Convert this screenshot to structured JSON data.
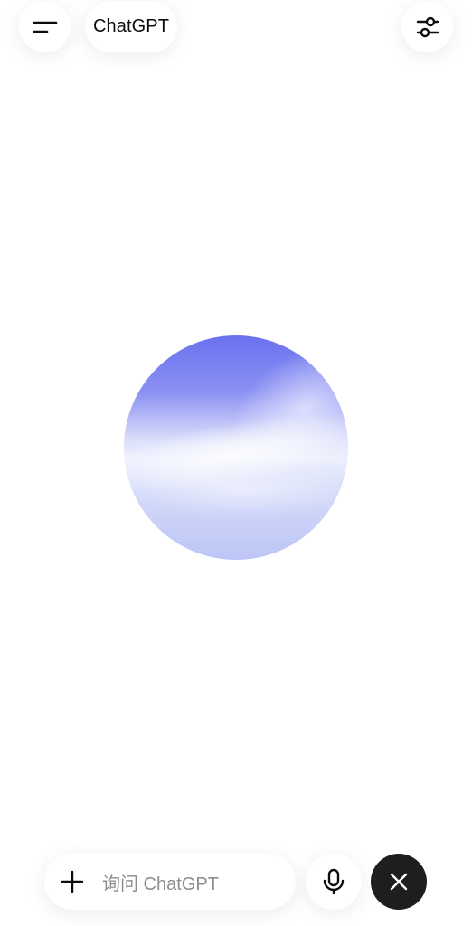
{
  "header": {
    "menu_icon": "menu-icon",
    "title": "ChatGPT",
    "settings_icon": "sliders-icon"
  },
  "voice": {
    "orb_colors": {
      "top": "#6a71ee",
      "middle": "#edf0fd",
      "bottom": "#bcc5f6"
    }
  },
  "composer": {
    "add_icon": "plus-icon",
    "placeholder": "询问 ChatGPT",
    "mic_icon": "microphone-icon",
    "close_icon": "close-icon"
  },
  "colors": {
    "background": "#ffffff",
    "text": "#0d0d0d",
    "placeholder": "#8e8e8e",
    "close_button": "#1e1e1e"
  }
}
